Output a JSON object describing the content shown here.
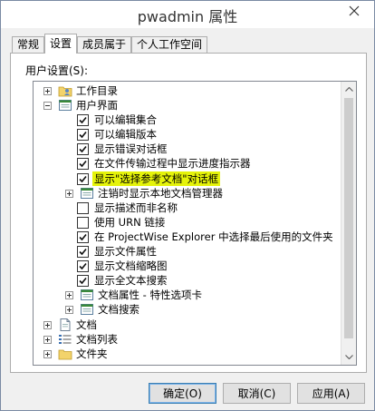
{
  "window": {
    "title": "pwadmin 属性"
  },
  "tabs": [
    {
      "label": "常规"
    },
    {
      "label": "设置",
      "active": true
    },
    {
      "label": "成员属于"
    },
    {
      "label": "个人工作空间"
    }
  ],
  "settings": {
    "section_label": "用户设置(S):",
    "tree": [
      {
        "label": "工作目录",
        "expander": "plus",
        "icon": "folder-user-icon"
      },
      {
        "label": "用户界面",
        "expander": "minus",
        "icon": "window-settings-icon"
      },
      {
        "label": "可以编辑集合",
        "checked": true
      },
      {
        "label": "可以编辑版本",
        "checked": true
      },
      {
        "label": "显示错误对话框",
        "checked": true
      },
      {
        "label": "在文件传输过程中显示进度指示器",
        "checked": true
      },
      {
        "label": "显示\"选择参考文档\"对话框",
        "checked": true,
        "highlighted": true,
        "highlight_color": "#e5f30a"
      },
      {
        "label": "注销时显示本地文档管理器",
        "expander": "plus",
        "icon": "window-settings-icon"
      },
      {
        "label": "显示描述而非名称",
        "checked": false
      },
      {
        "label": "使用 URN 链接",
        "checked": false
      },
      {
        "label": "在 ProjectWise Explorer 中选择最后使用的文件夹",
        "checked": true
      },
      {
        "label": "显示文件属性",
        "checked": true
      },
      {
        "label": "显示文档缩略图",
        "checked": true
      },
      {
        "label": "显示全文本搜索",
        "checked": true
      },
      {
        "label": "文档属性 - 特性选项卡",
        "expander": "plus",
        "icon": "window-settings-icon"
      },
      {
        "label": "文档搜索",
        "expander": "plus",
        "icon": "window-settings-icon"
      },
      {
        "label": "文档",
        "expander": "plus",
        "icon": "document-icon"
      },
      {
        "label": "文档列表",
        "expander": "plus",
        "icon": "list-icon"
      },
      {
        "label": "文件夹",
        "expander": "plus",
        "icon": "folder-icon"
      }
    ]
  },
  "buttons": {
    "ok": "确定(O)",
    "cancel": "取消(C)",
    "apply": "应用(A)"
  },
  "colors": {
    "highlight": "#e5f30a",
    "window_border": "#7a8aa3"
  }
}
